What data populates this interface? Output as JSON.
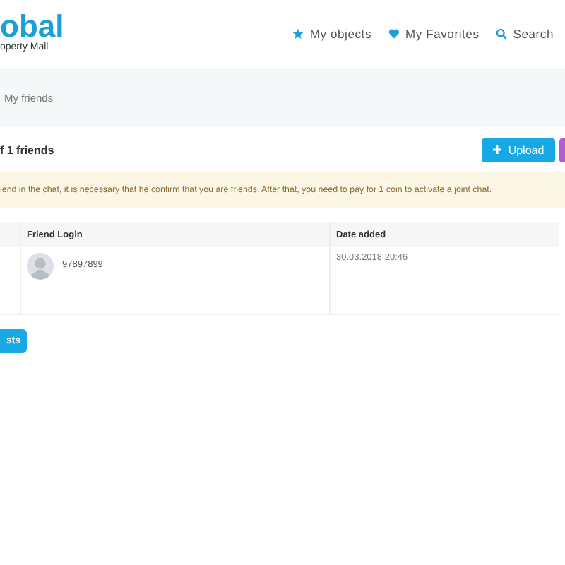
{
  "logo": {
    "name": "obal",
    "tagline": "operty Mall"
  },
  "nav": [
    {
      "kind": "star",
      "label": "My objects"
    },
    {
      "kind": "heart",
      "label": "My Favorites"
    },
    {
      "kind": "search",
      "label": "Search"
    }
  ],
  "breadcrumb": "My friends",
  "heading": "f 1 friends",
  "upload_button": "Upload",
  "alert": "iend in the chat, it is necessary that he confirm that you are friends.     After that, you need to pay for 1 coin to activate a joint chat.",
  "table": {
    "columns": [
      "Friend Login",
      "Date added"
    ],
    "rows": [
      {
        "login": "97897899",
        "date": "30.03.2018 20:46"
      }
    ]
  },
  "bottom_button": "sts"
}
